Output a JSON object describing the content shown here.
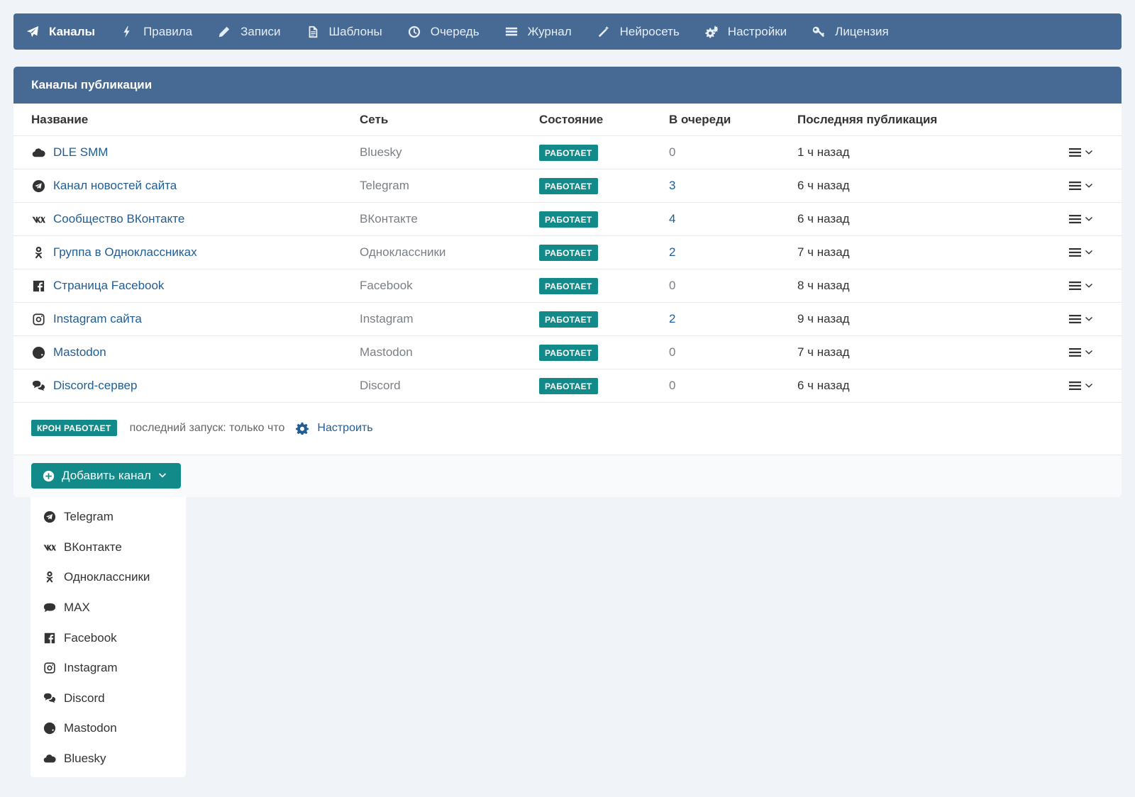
{
  "nav": {
    "items": [
      {
        "label": "Каналы",
        "icon": "paper-plane-icon",
        "active": true
      },
      {
        "label": "Правила",
        "icon": "bolt-icon"
      },
      {
        "label": "Записи",
        "icon": "pencil-icon"
      },
      {
        "label": "Шаблоны",
        "icon": "file-text-icon"
      },
      {
        "label": "Очередь",
        "icon": "clock-icon"
      },
      {
        "label": "Журнал",
        "icon": "list-icon"
      },
      {
        "label": "Нейросеть",
        "icon": "magic-wand-icon"
      },
      {
        "label": "Настройки",
        "icon": "cogs-icon"
      },
      {
        "label": "Лицензия",
        "icon": "key-icon"
      }
    ]
  },
  "panel": {
    "title": "Каналы публикации",
    "columns": {
      "name": "Название",
      "network": "Сеть",
      "state": "Состояние",
      "queue": "В очереди",
      "last": "Последняя публикация"
    },
    "rows": [
      {
        "name": "DLE SMM",
        "icon": "cloud-icon",
        "network": "Bluesky",
        "state": "РАБОТАЕТ",
        "queue": "0",
        "last": "1 ч назад"
      },
      {
        "name": "Канал новостей сайта",
        "icon": "telegram-icon",
        "network": "Telegram",
        "state": "РАБОТАЕТ",
        "queue": "3",
        "last": "6 ч назад"
      },
      {
        "name": "Сообщество ВКонтакте",
        "icon": "vk-icon",
        "network": "ВКонтакте",
        "state": "РАБОТАЕТ",
        "queue": "4",
        "last": "6 ч назад"
      },
      {
        "name": "Группа в Одноклассниках",
        "icon": "odnoklassniki-icon",
        "network": "Одноклассники",
        "state": "РАБОТАЕТ",
        "queue": "2",
        "last": "7 ч назад"
      },
      {
        "name": "Страница Facebook",
        "icon": "facebook-icon",
        "network": "Facebook",
        "state": "РАБОТАЕТ",
        "queue": "0",
        "last": "8 ч назад"
      },
      {
        "name": "Instagram сайта",
        "icon": "instagram-icon",
        "network": "Instagram",
        "state": "РАБОТАЕТ",
        "queue": "2",
        "last": "9 ч назад"
      },
      {
        "name": "Mastodon",
        "icon": "globe-icon",
        "network": "Mastodon",
        "state": "РАБОТАЕТ",
        "queue": "0",
        "last": "7 ч назад"
      },
      {
        "name": "Discord-сервер",
        "icon": "comments-icon",
        "network": "Discord",
        "state": "РАБОТАЕТ",
        "queue": "0",
        "last": "6 ч назад"
      }
    ]
  },
  "cron": {
    "badge": "КРОН РАБОТАЕТ",
    "text": "последний запуск: только что",
    "configure": "Настроить"
  },
  "add_button": {
    "label": "Добавить канал"
  },
  "dropdown": {
    "items": [
      {
        "label": "Telegram",
        "icon": "telegram-icon"
      },
      {
        "label": "ВКонтакте",
        "icon": "vk-icon"
      },
      {
        "label": "Одноклассники",
        "icon": "odnoklassniki-icon"
      },
      {
        "label": "MAX",
        "icon": "comment-icon"
      },
      {
        "label": "Facebook",
        "icon": "facebook-icon"
      },
      {
        "label": "Instagram",
        "icon": "instagram-icon"
      },
      {
        "label": "Discord",
        "icon": "comments-icon"
      },
      {
        "label": "Mastodon",
        "icon": "globe-icon"
      },
      {
        "label": "Bluesky",
        "icon": "cloud-icon"
      }
    ]
  },
  "colors": {
    "nav_bg": "#466a94",
    "badge_bg": "#138a8a",
    "link": "#1f5d95"
  }
}
